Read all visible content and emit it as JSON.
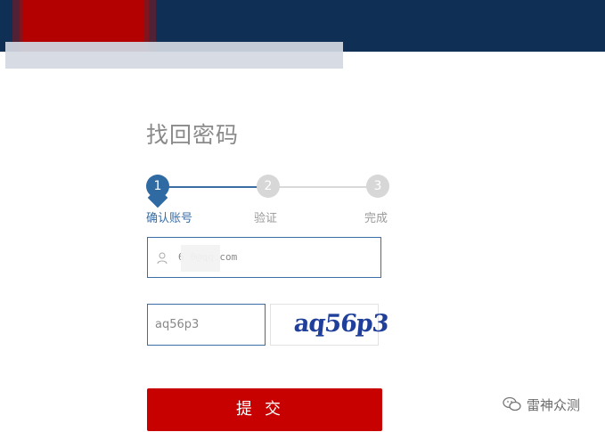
{
  "header": {
    "colors": {
      "bar": "#0f2f55",
      "brand": "#b30000"
    }
  },
  "page": {
    "title": "找回密码"
  },
  "steps": [
    {
      "number": "1",
      "label": "确认账号"
    },
    {
      "number": "2",
      "label": "验证"
    },
    {
      "number": "3",
      "label": "完成"
    }
  ],
  "form": {
    "email_value": "6        0@qq.com",
    "captcha_value": "aq56p3",
    "captcha_image_text": "aq56p3",
    "submit_label": "提交"
  },
  "watermark": {
    "text": "雷神众测"
  },
  "colors": {
    "accent": "#3a6ea5",
    "submit": "#c70000"
  },
  "icons": {
    "user": "user-icon",
    "wechat": "wechat-icon"
  }
}
